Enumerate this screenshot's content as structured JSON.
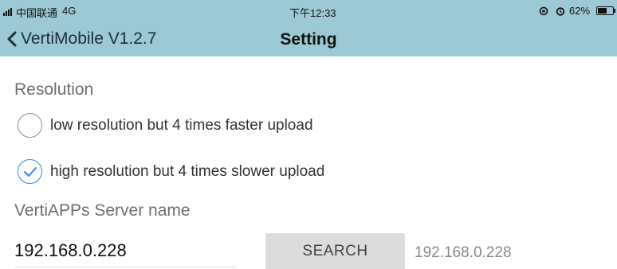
{
  "status_bar": {
    "carrier": "中国联通",
    "network": "4G",
    "time": "下午12:33",
    "battery": "62%",
    "battery_level": 0.62,
    "icons": [
      "signal-icon",
      "orientation-lock-icon",
      "alarm-icon",
      "battery-icon"
    ]
  },
  "nav": {
    "back_label": "VertiMobile V1.2.7",
    "title": "Setting"
  },
  "resolution": {
    "heading": "Resolution",
    "options": [
      {
        "label": "low resolution but 4 times faster upload",
        "selected": false
      },
      {
        "label": "high resolution but 4 times slower upload",
        "selected": true
      }
    ]
  },
  "server": {
    "heading": "VertiAPPs Server name",
    "input_value": "192.168.0.228",
    "search_label": "SEARCH",
    "result": "192.168.0.228"
  },
  "colors": {
    "header_bg": "#9dc9d4",
    "radio_selected": "#2f86e8",
    "button_bg": "#dcdcdc"
  }
}
